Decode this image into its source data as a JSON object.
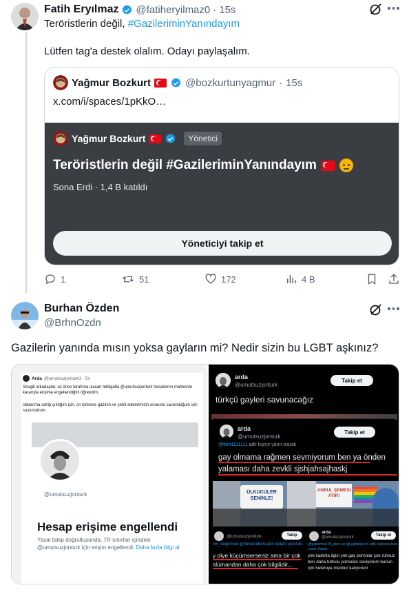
{
  "tweet1": {
    "name": "Fatih Eryılmaz",
    "handle": "@fatiheryilmaz0",
    "time": "15s",
    "line1_text": "Teröristlerin değil, ",
    "line1_hashtag": "#GazileriminYanındayım",
    "line2": "Lütfen tag'a destek olalım. Odayı paylaşalım.",
    "quote": {
      "name": "Yağmur Bozkurt",
      "handle": "@bozkurtunyagmur",
      "time": "15s",
      "link": "x.com/i/spaces/1pKkO…",
      "space": {
        "host_name": "Yağmur Bozkurt",
        "role_badge": "Yönetici",
        "title": "Teröristlerin değil #GazileriminYanındayım",
        "status": "Sona Erdi",
        "listeners": "1,4 B katıldı",
        "follow_button": "Yöneticiyi takip et"
      }
    },
    "actions": {
      "replies": "1",
      "retweets": "51",
      "likes": "172",
      "views": "4 B"
    }
  },
  "tweet2": {
    "name": "Burhan Özden",
    "handle": "@BrhnOzdn",
    "text": "Gazilerin yanında mısın yoksa gayların mi? Nedir sizin bu LGBT aşkınız?",
    "left_image": {
      "name": "Arda",
      "handle": "@umutsuzjonturk1 · 5s",
      "p1": "Sevgili arkadaşlar, az önce tarafıma ulaşan tebligatla @umutsuzjonturk hesabımın mahkeme kararıyla erişime engellendiğini öğrendim.",
      "p2": "Vatanıma sahip çıktığım için, on binlerce gazinin ve şehit ailelerimizin onurunu savunduğum için susturuldum.",
      "profile_handle": "@umutsuzjonturk",
      "blocked_title": "Hesap erişime engellendi",
      "blocked_text": "Yasal talep doğrultusunda, TR sınırları içindeki @umutsuzjonturk için erişim engellendi.",
      "blocked_link": "Daha fazla bilgi al"
    },
    "right_image": {
      "name": "arda",
      "handle": "@umutsuzjonturk",
      "follow": "Takip et",
      "text1": "türkçü gayleri savunacağız",
      "reply_to": "@fani1111111",
      "reply_suffix": " adlı kişiye yanıt olarak",
      "text2": "gay olmama rağmen sevmiyorum ben ya önden yalaması daha zevkli sjshjahsajhaskj",
      "sign1": "ÜLKÜCÜLER SENİNLE!",
      "sign2": "ANBUL ŞEMESİ ATIR!",
      "mini_follow": "Takip",
      "mini_follow2": "Takip et",
      "bottom_left_handle": "@umutsuzjonturk",
      "bottom_left_reply": "lim_degerli ve @helsenebolu adlı kullanı yanıt olarak",
      "bottom_left_text": "y diye küçümserseniz ama bir çok slümandan daha çok bilgilidir...",
      "bottom_right_name": "arda",
      "bottom_right_handle": "@umutsuzjonturk",
      "bottom_right_reply": "@yakamoz78_ates ve @yigitargunn adlı kullanıcılara yanıt olarak",
      "bottom_right_text": "yok kadınla ilgisi yok gay pornolar çok ruhsuz ben daha tutkulu pornoları seviyorum bunun için heteroya mecbur kalıyorum"
    }
  }
}
